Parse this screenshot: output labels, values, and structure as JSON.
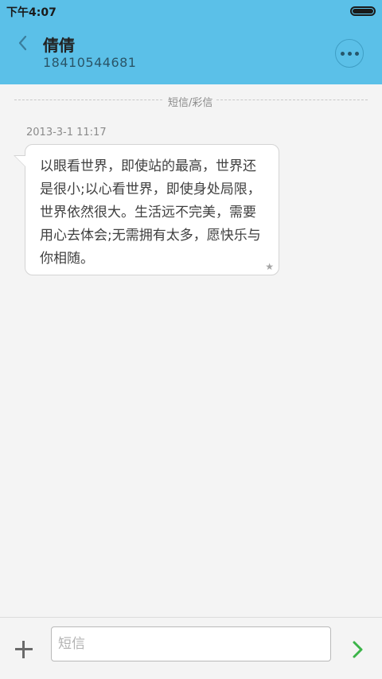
{
  "status_bar": {
    "time": "下午4:07",
    "battery_level": 1.0
  },
  "header": {
    "contact_name": "倩倩",
    "contact_number": "18410544681",
    "back_icon": "chevron-left-icon",
    "more_icon": "more-horizontal-icon"
  },
  "thread": {
    "divider_label": "短信/彩信",
    "messages": [
      {
        "timestamp": "2013-3-1 11:17",
        "text": "以眼看世界，即使站的最高，世界还是很小;以心看世界，即使身处局限，世界依然很大。生活远不完美，需要用心去体会;无需拥有太多，愿快乐与你相随。",
        "starred": true
      }
    ]
  },
  "composer": {
    "placeholder": "短信",
    "value": "",
    "add_icon": "plus-icon",
    "send_icon": "chevron-right-icon"
  },
  "colors": {
    "header_bg": "#5bc0e8",
    "page_bg": "#f4f4f4",
    "send_green": "#3cb449"
  }
}
